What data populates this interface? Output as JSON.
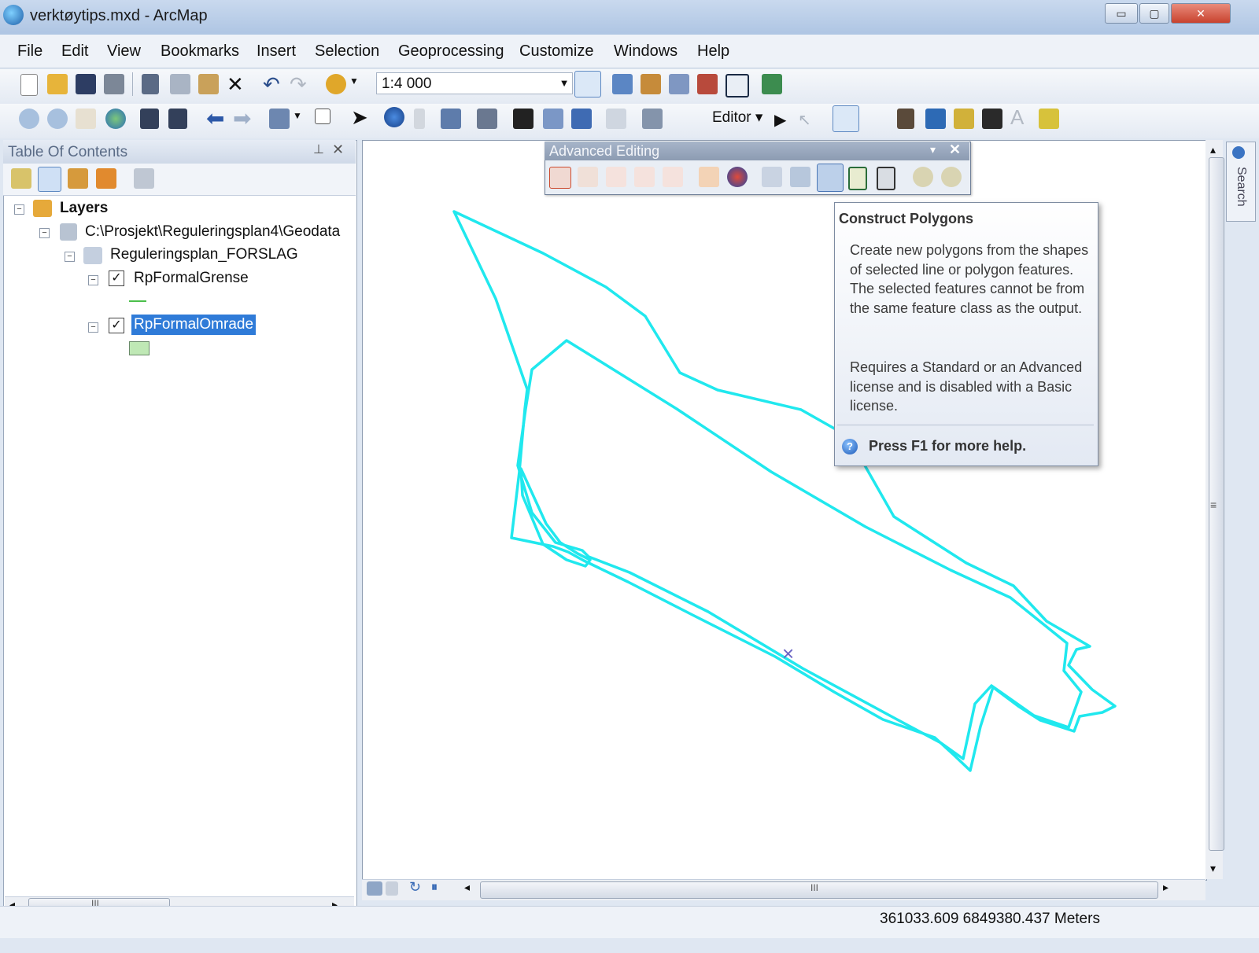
{
  "window": {
    "title": "verktøytips.mxd - ArcMap",
    "minimize": "▭",
    "maximize": "▢",
    "close": "✕"
  },
  "menu": [
    "File",
    "Edit",
    "View",
    "Bookmarks",
    "Insert",
    "Selection",
    "Geoprocessing",
    "Customize",
    "Windows",
    "Help"
  ],
  "standard_toolbar": {
    "scale_value": "1:4 000",
    "scale_arrow": "▼"
  },
  "editor_toolbar": {
    "editor_label": "Editor ▾"
  },
  "toc": {
    "title": "Table Of Contents",
    "pin": "⊥",
    "close": "✕",
    "layers_root": "Layers",
    "database_path": "C:\\Prosjekt\\Reguleringsplan4\\Geodata",
    "feature_dataset": "Reguleringsplan_FORSLAG",
    "layer1": "RpFormalGrense",
    "layer2": "RpFormalOmrade",
    "scroll_mark": "III",
    "scroll_left": "◂",
    "scroll_right": "▸"
  },
  "advanced_editing": {
    "title": "Advanced Editing",
    "dropdown": "▾",
    "close": "✕"
  },
  "tooltip": {
    "title": "Construct Polygons",
    "body": "Create new polygons from the shapes of selected line or polygon features. The selected features cannot be from the same feature class as the output.",
    "license": "Requires a Standard or an Advanced license and is disabled with a Basic license.",
    "help_icon": "?",
    "help": "Press F1 for more help."
  },
  "map": {
    "cursor": "×",
    "scroll_mark": "III",
    "vscroll_mark": "≡",
    "scroll_up": "▴",
    "scroll_down": "▾",
    "scroll_left": "◂",
    "scroll_right": "▸"
  },
  "search_tab": "Search",
  "status": {
    "coordinates": "361033.609  6849380.437 Meters"
  },
  "colors": {
    "feature_outline": "#20e8ee",
    "selection_highlight": "#2f7bd8"
  }
}
